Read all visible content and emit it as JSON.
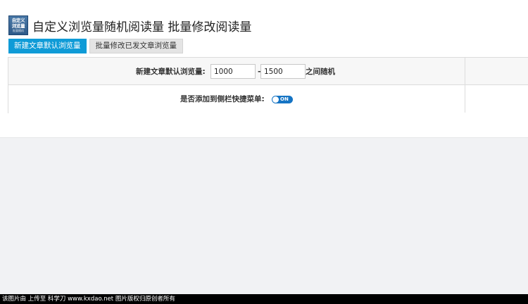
{
  "header": {
    "logo_lines": [
      "自定义",
      "浏览量",
      "批量随机"
    ],
    "title": "自定义浏览量随机阅读量 批量修改阅读量"
  },
  "tabs": [
    {
      "label": "新建文章默认浏览量",
      "active": true
    },
    {
      "label": "批量修改已发文章浏览量",
      "active": false
    }
  ],
  "form": {
    "default_views_label": "新建文章默认浏览量:",
    "min_value": "1000",
    "separator": "-",
    "max_value": "1500",
    "range_suffix": "之间随机",
    "sidebar_label": "是否添加到侧栏快捷菜单:",
    "sidebar_toggle": {
      "state": "ON",
      "on": true
    }
  },
  "footer": {
    "watermark": "该图片由   上传至 科学刀 www.kxdao.net 图片版权归原创者所有"
  },
  "colors": {
    "accent": "#0f9bd7",
    "toggle": "#1574c4",
    "background": "#f1f2f4"
  }
}
